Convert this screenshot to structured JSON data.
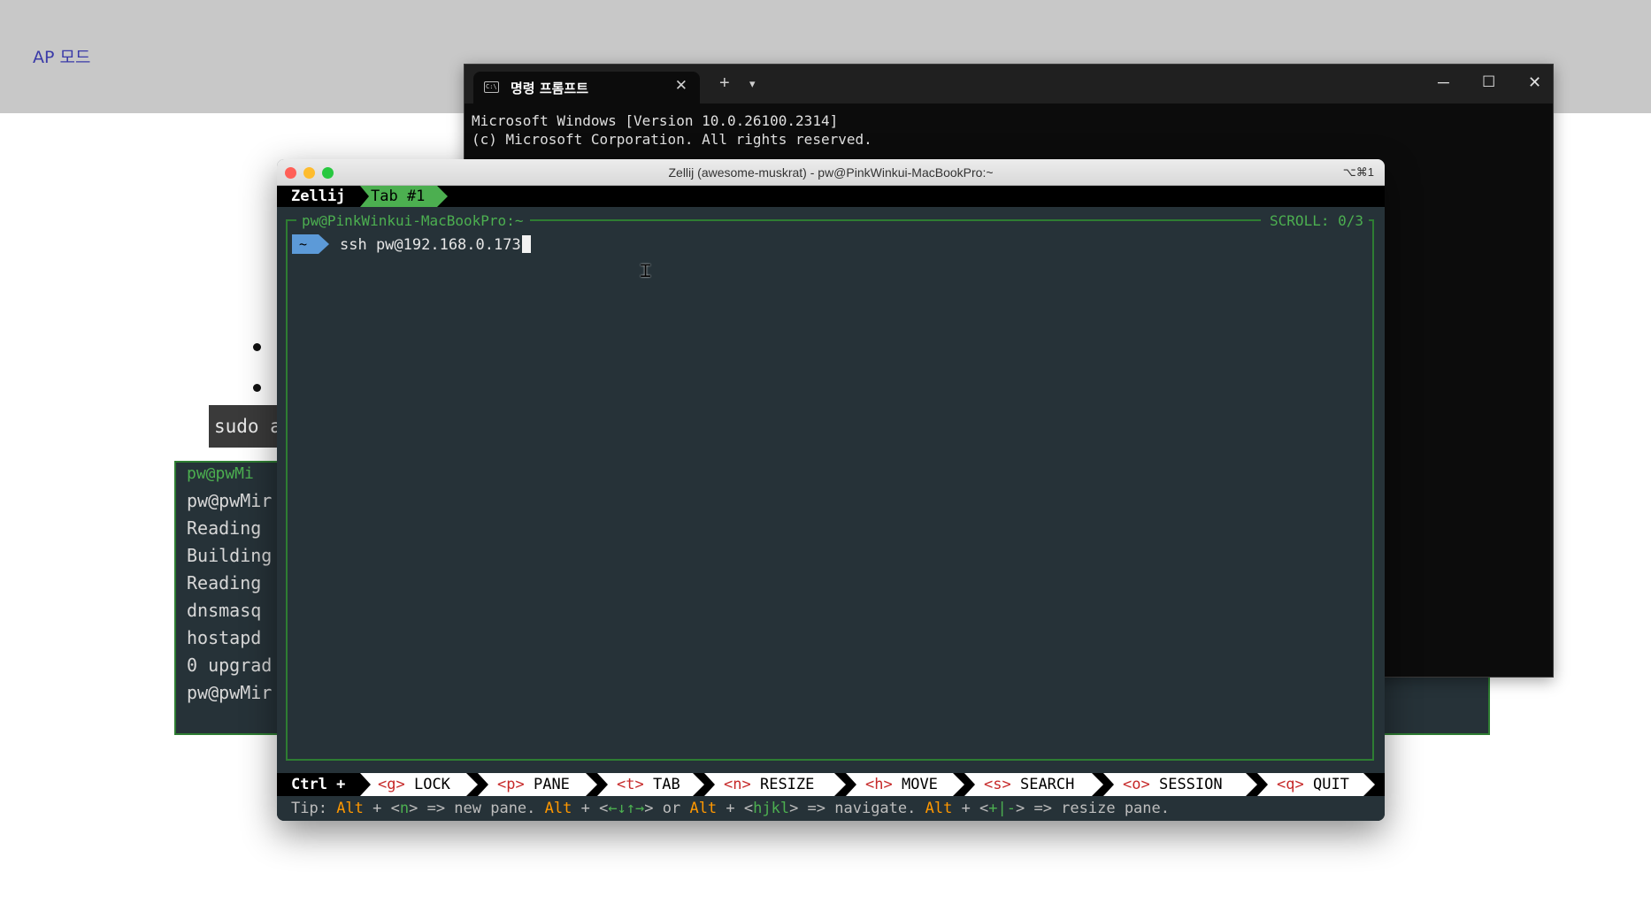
{
  "doc": {
    "ap_mode_label": "AP 모드",
    "sudo_fragment": "sudo a",
    "bg_terminal": {
      "title": "pw@pwMi",
      "lines": [
        "pw@pwMir",
        "Reading",
        "Building",
        "Reading",
        "dnsmasq",
        "hostapd",
        "0 upgrad",
        "pw@pwMir"
      ]
    }
  },
  "windows_terminal": {
    "tab_label": "명령 프롬프트",
    "tab_icon": "cmd-icon",
    "new_tab": "+",
    "dropdown": "⌄",
    "lines": [
      "Microsoft Windows [Version 10.0.26100.2314]",
      "(c) Microsoft Corporation. All rights reserved."
    ]
  },
  "zellij": {
    "window_title": "Zellij (awesome-muskrat) - pw@PinkWinkui-MacBookPro:~",
    "shortcut": "⌥⌘1",
    "brand": "Zellij",
    "tab_label": "Tab #1",
    "pane_title": "pw@PinkWinkui-MacBookPro:~",
    "scroll_label": "SCROLL:  0/3",
    "prompt_symbol": "~",
    "command": "ssh pw@192.168.0.173",
    "ctrl_label": "Ctrl +",
    "keys": [
      {
        "hotkey": "<g>",
        "label": "LOCK"
      },
      {
        "hotkey": "<p>",
        "label": "PANE"
      },
      {
        "hotkey": "<t>",
        "label": "TAB"
      },
      {
        "hotkey": "<n>",
        "label": "RESIZE"
      },
      {
        "hotkey": "<h>",
        "label": "MOVE"
      },
      {
        "hotkey": "<s>",
        "label": "SEARCH"
      },
      {
        "hotkey": "<o>",
        "label": "SESSION"
      },
      {
        "hotkey": "<q>",
        "label": "QUIT"
      }
    ],
    "tip": {
      "prefix": "Tip: ",
      "alt": "Alt",
      "plus": " + <",
      "n": "n",
      "new_pane": "> => new pane. ",
      "arrows": "←↓↑→",
      "or": "> or ",
      "hjkl": "hjkl",
      "navigate": "> => navigate. ",
      "resize_keys": "+|-",
      "resize": "> => resize pane."
    }
  },
  "colors": {
    "zellij_green": "#4caf50",
    "zellij_bg": "#263238",
    "tip_orange": "#ff9800",
    "hotkey_red": "#c62828"
  }
}
